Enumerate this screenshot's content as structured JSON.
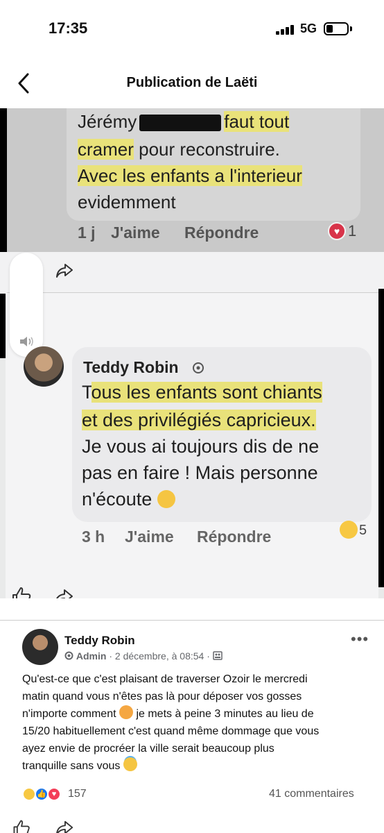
{
  "status_bar": {
    "time": "17:35",
    "network": "5G"
  },
  "header": {
    "title": "Publication de Laëti"
  },
  "screenshot": {
    "comment1": {
      "author_first": "Jérémy",
      "text_after_redaction": "faut tout",
      "line2_highlight": "cramer",
      "line2_rest": " pour reconstruire.",
      "line3": "Avec les enfants a l'interieur",
      "line4": "evidemment",
      "time": "1 j",
      "like": "J'aime",
      "reply": "Répondre",
      "reaction_count": "1"
    },
    "comment2": {
      "author": "Teddy Robin",
      "line1_pre": "T",
      "line1_highlight": "ous les enfants sont chiants",
      "line2": "et des privilégiés capricieux.",
      "line3": "Je vous ai toujours dis de ne",
      "line4": "pas en faire ! Mais personne",
      "line5": "n'écoute",
      "time": "3 h",
      "like": "J'aime",
      "reply": "Répondre",
      "reaction_count": "5"
    }
  },
  "post": {
    "author": "Teddy Robin",
    "role": "Admin",
    "date": " · 2 décembre, à 08:54 · ",
    "lines": [
      "Qu'est-ce que c'est plaisant de traverser Ozoir le mercredi",
      "matin quand vous n'êtes pas là pour déposer vos gosses",
      "n'importe comment",
      " je mets à peine 3 minutes au lieu de",
      "15/20 habituellement c'est quand même dommage que vous",
      "ayez envie de procréer la ville serait beaucoup plus",
      "tranquille sans vous"
    ],
    "reaction_count": "157",
    "comments": "41 commentaires"
  },
  "icons": [
    "back-chevron-icon",
    "share-icon",
    "like-icon",
    "volume-icon",
    "verified-badge-icon",
    "more-icon",
    "group-icon"
  ]
}
